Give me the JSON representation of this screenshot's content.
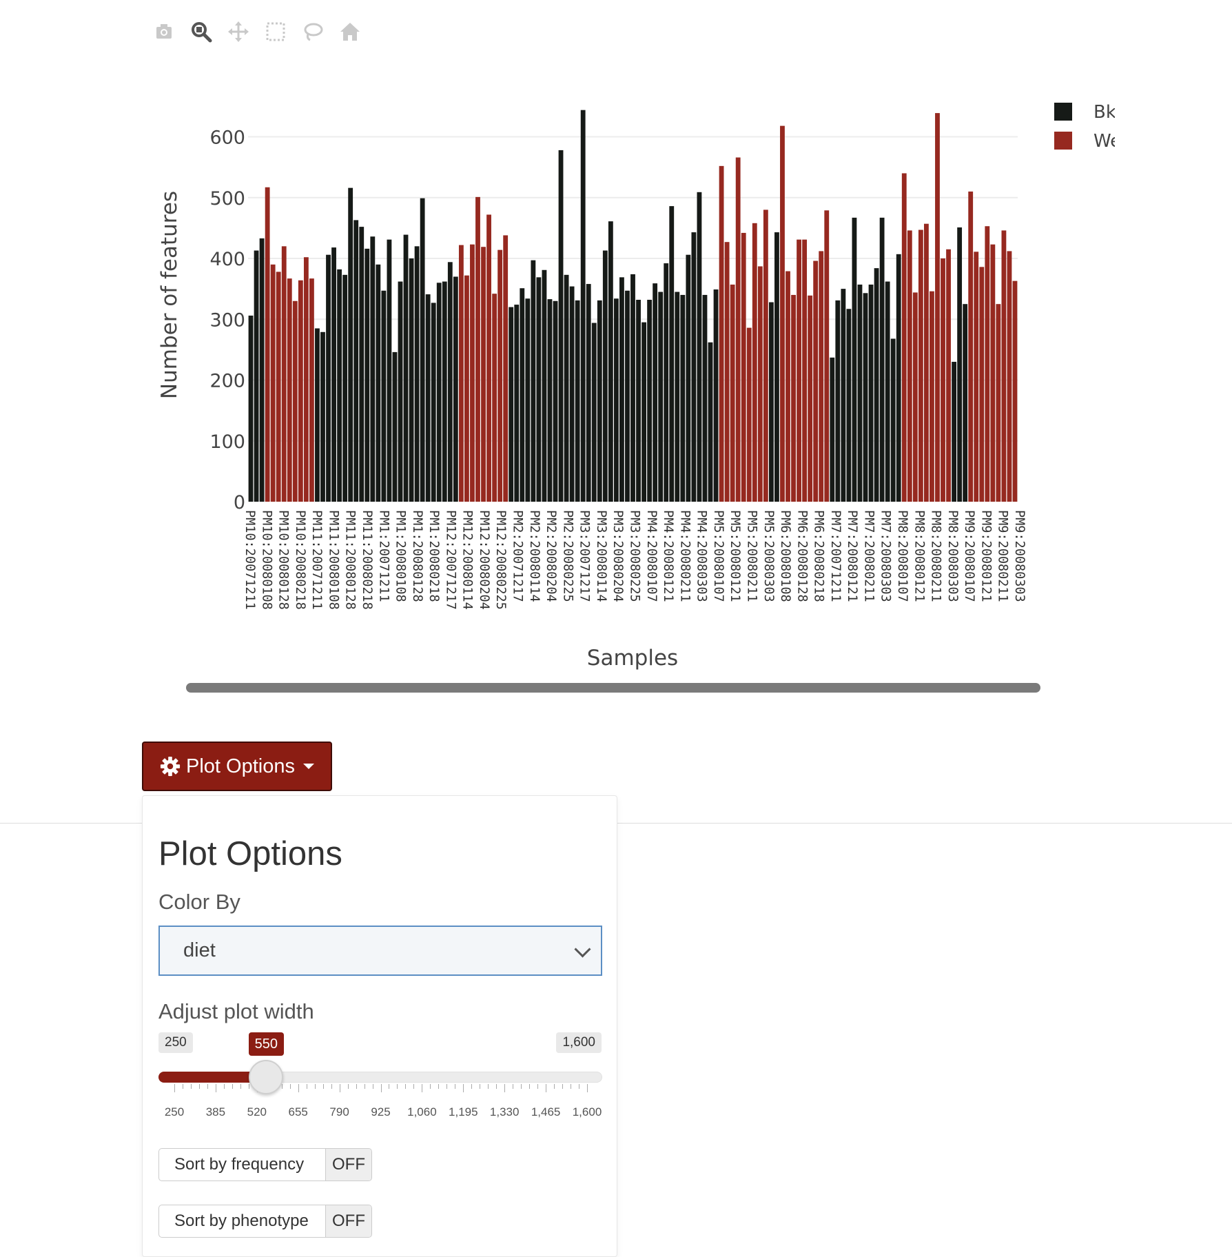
{
  "toolbar": {
    "buttons": [
      {
        "name": "download-plot-icon"
      },
      {
        "name": "zoom-icon"
      },
      {
        "name": "pan-icon"
      },
      {
        "name": "box-select-icon"
      },
      {
        "name": "lasso-select-icon"
      },
      {
        "name": "reset-axes-home-icon"
      }
    ]
  },
  "colors": {
    "series_dark": "#161a17",
    "series_red": "#962920",
    "brand": "#8b1d13",
    "select_border": "#5b8ec4"
  },
  "chart_data": {
    "type": "bar",
    "title": "",
    "xlabel": "Samples",
    "ylabel": "Number of features",
    "ylim": [
      0,
      650
    ],
    "yticks": [
      0,
      100,
      200,
      300,
      400,
      500,
      600
    ],
    "grid": true,
    "legend_position": "top-right",
    "x_tick_labels": [
      "PM10:20071211",
      "PM10:20080108",
      "PM10:20080128",
      "PM10:20080218",
      "PM11:20071211",
      "PM11:20080108",
      "PM11:20080128",
      "PM11:20080218",
      "PM1:20071211",
      "PM1:20080108",
      "PM1:20080128",
      "PM1:20080218",
      "PM12:20071217",
      "PM12:20080114",
      "PM12:20080204",
      "PM12:20080225",
      "PM2:20071217",
      "PM2:20080114",
      "PM2:20080204",
      "PM2:20080225",
      "PM3:20071217",
      "PM3:20080114",
      "PM3:20080204",
      "PM3:20080225",
      "PM4:20080107",
      "PM4:20080121",
      "PM4:20080211",
      "PM4:20080303",
      "PM5:20080107",
      "PM5:20080121",
      "PM5:20080211",
      "PM5:20080303",
      "PM6:20080108",
      "PM6:20080128",
      "PM6:20080218",
      "PM7:20071211",
      "PM7:20080121",
      "PM7:20080211",
      "PM7:20080303",
      "PM8:20080107",
      "PM8:20080121",
      "PM8:20080211",
      "PM8:20080303",
      "PM9:20080107",
      "PM9:20080121",
      "PM9:20080211",
      "PM9:20080303"
    ],
    "series": [
      {
        "name": "Bk",
        "color": "#161a17"
      },
      {
        "name": "We",
        "color": "#962920"
      }
    ],
    "bars": [
      {
        "s": 0,
        "v": 306
      },
      {
        "s": 0,
        "v": 413
      },
      {
        "s": 0,
        "v": 433
      },
      {
        "s": 1,
        "v": 517
      },
      {
        "s": 1,
        "v": 390
      },
      {
        "s": 1,
        "v": 378
      },
      {
        "s": 1,
        "v": 420
      },
      {
        "s": 1,
        "v": 367
      },
      {
        "s": 1,
        "v": 330
      },
      {
        "s": 1,
        "v": 364
      },
      {
        "s": 1,
        "v": 402
      },
      {
        "s": 1,
        "v": 367
      },
      {
        "s": 0,
        "v": 285
      },
      {
        "s": 0,
        "v": 279
      },
      {
        "s": 0,
        "v": 406
      },
      {
        "s": 0,
        "v": 418
      },
      {
        "s": 0,
        "v": 382
      },
      {
        "s": 0,
        "v": 373
      },
      {
        "s": 0,
        "v": 516
      },
      {
        "s": 0,
        "v": 463
      },
      {
        "s": 0,
        "v": 452
      },
      {
        "s": 0,
        "v": 416
      },
      {
        "s": 0,
        "v": 436
      },
      {
        "s": 0,
        "v": 390
      },
      {
        "s": 0,
        "v": 347
      },
      {
        "s": 0,
        "v": 431
      },
      {
        "s": 0,
        "v": 246
      },
      {
        "s": 0,
        "v": 362
      },
      {
        "s": 0,
        "v": 439
      },
      {
        "s": 0,
        "v": 400
      },
      {
        "s": 0,
        "v": 420
      },
      {
        "s": 0,
        "v": 499
      },
      {
        "s": 0,
        "v": 341
      },
      {
        "s": 0,
        "v": 327
      },
      {
        "s": 0,
        "v": 360
      },
      {
        "s": 0,
        "v": 362
      },
      {
        "s": 0,
        "v": 394
      },
      {
        "s": 0,
        "v": 370
      },
      {
        "s": 1,
        "v": 422
      },
      {
        "s": 1,
        "v": 372
      },
      {
        "s": 1,
        "v": 423
      },
      {
        "s": 1,
        "v": 501
      },
      {
        "s": 1,
        "v": 419
      },
      {
        "s": 1,
        "v": 472
      },
      {
        "s": 1,
        "v": 342
      },
      {
        "s": 1,
        "v": 414
      },
      {
        "s": 1,
        "v": 438
      },
      {
        "s": 0,
        "v": 320
      },
      {
        "s": 0,
        "v": 324
      },
      {
        "s": 0,
        "v": 351
      },
      {
        "s": 0,
        "v": 334
      },
      {
        "s": 0,
        "v": 397
      },
      {
        "s": 0,
        "v": 369
      },
      {
        "s": 0,
        "v": 381
      },
      {
        "s": 0,
        "v": 333
      },
      {
        "s": 0,
        "v": 330
      },
      {
        "s": 0,
        "v": 578
      },
      {
        "s": 0,
        "v": 373
      },
      {
        "s": 0,
        "v": 354
      },
      {
        "s": 0,
        "v": 331
      },
      {
        "s": 0,
        "v": 644
      },
      {
        "s": 0,
        "v": 358
      },
      {
        "s": 0,
        "v": 294
      },
      {
        "s": 0,
        "v": 331
      },
      {
        "s": 0,
        "v": 413
      },
      {
        "s": 0,
        "v": 461
      },
      {
        "s": 0,
        "v": 334
      },
      {
        "s": 0,
        "v": 369
      },
      {
        "s": 0,
        "v": 347
      },
      {
        "s": 0,
        "v": 374
      },
      {
        "s": 0,
        "v": 332
      },
      {
        "s": 0,
        "v": 295
      },
      {
        "s": 0,
        "v": 332
      },
      {
        "s": 0,
        "v": 359
      },
      {
        "s": 0,
        "v": 345
      },
      {
        "s": 0,
        "v": 392
      },
      {
        "s": 0,
        "v": 486
      },
      {
        "s": 0,
        "v": 345
      },
      {
        "s": 0,
        "v": 340
      },
      {
        "s": 0,
        "v": 406
      },
      {
        "s": 0,
        "v": 443
      },
      {
        "s": 0,
        "v": 509
      },
      {
        "s": 0,
        "v": 340
      },
      {
        "s": 0,
        "v": 262
      },
      {
        "s": 0,
        "v": 349
      },
      {
        "s": 1,
        "v": 552
      },
      {
        "s": 1,
        "v": 427
      },
      {
        "s": 1,
        "v": 357
      },
      {
        "s": 1,
        "v": 566
      },
      {
        "s": 1,
        "v": 442
      },
      {
        "s": 1,
        "v": 286
      },
      {
        "s": 1,
        "v": 458
      },
      {
        "s": 1,
        "v": 387
      },
      {
        "s": 1,
        "v": 480
      },
      {
        "s": 0,
        "v": 328
      },
      {
        "s": 0,
        "v": 443
      },
      {
        "s": 1,
        "v": 618
      },
      {
        "s": 1,
        "v": 379
      },
      {
        "s": 1,
        "v": 340
      },
      {
        "s": 1,
        "v": 431
      },
      {
        "s": 1,
        "v": 431
      },
      {
        "s": 1,
        "v": 339
      },
      {
        "s": 1,
        "v": 396
      },
      {
        "s": 1,
        "v": 412
      },
      {
        "s": 1,
        "v": 479
      },
      {
        "s": 0,
        "v": 237
      },
      {
        "s": 0,
        "v": 331
      },
      {
        "s": 0,
        "v": 350
      },
      {
        "s": 0,
        "v": 317
      },
      {
        "s": 0,
        "v": 467
      },
      {
        "s": 0,
        "v": 357
      },
      {
        "s": 0,
        "v": 343
      },
      {
        "s": 0,
        "v": 357
      },
      {
        "s": 0,
        "v": 384
      },
      {
        "s": 0,
        "v": 467
      },
      {
        "s": 0,
        "v": 362
      },
      {
        "s": 0,
        "v": 268
      },
      {
        "s": 0,
        "v": 407
      },
      {
        "s": 1,
        "v": 540
      },
      {
        "s": 1,
        "v": 446
      },
      {
        "s": 1,
        "v": 344
      },
      {
        "s": 1,
        "v": 447
      },
      {
        "s": 1,
        "v": 457
      },
      {
        "s": 1,
        "v": 346
      },
      {
        "s": 1,
        "v": 639
      },
      {
        "s": 1,
        "v": 400
      },
      {
        "s": 1,
        "v": 415
      },
      {
        "s": 0,
        "v": 230
      },
      {
        "s": 0,
        "v": 451
      },
      {
        "s": 0,
        "v": 325
      },
      {
        "s": 1,
        "v": 510
      },
      {
        "s": 1,
        "v": 411
      },
      {
        "s": 1,
        "v": 386
      },
      {
        "s": 1,
        "v": 453
      },
      {
        "s": 1,
        "v": 423
      },
      {
        "s": 1,
        "v": 325
      },
      {
        "s": 1,
        "v": 446
      },
      {
        "s": 1,
        "v": 412
      },
      {
        "s": 1,
        "v": 363
      }
    ]
  },
  "plot_options": {
    "button_label": "Plot Options",
    "panel_title": "Plot Options",
    "color_by": {
      "label": "Color By",
      "value": "diet"
    },
    "width_slider": {
      "label": "Adjust plot width",
      "min_label": "250",
      "max_label": "1,600",
      "value_label": "550",
      "value": 550,
      "min": 250,
      "max": 1600,
      "tick_labels": [
        "250",
        "385",
        "520",
        "655",
        "790",
        "925",
        "1,060",
        "1,195",
        "1,330",
        "1,465",
        "1,600"
      ]
    },
    "sort_frequency": {
      "label": "Sort by frequency",
      "state": "OFF"
    },
    "sort_phenotype": {
      "label": "Sort by phenotype",
      "state": "OFF"
    }
  }
}
